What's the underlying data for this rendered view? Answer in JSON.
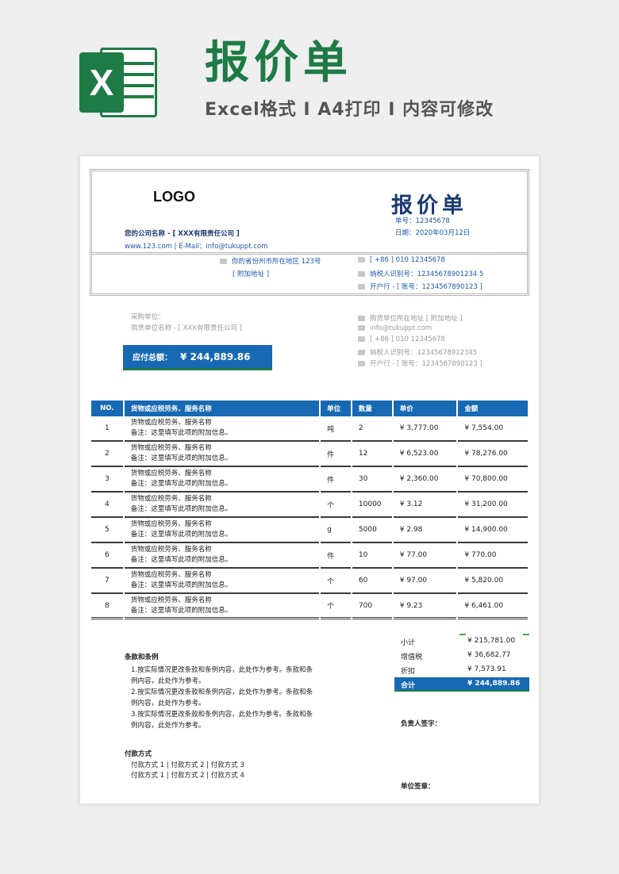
{
  "banner": {
    "icon_letter": "X",
    "title": "报价单",
    "subtitle": "Excel格式 I A4打印 I 内容可修改"
  },
  "header": {
    "logo": "LOGO",
    "doc_title": "报价单",
    "doc_no": "单号：12345678",
    "doc_date": "日期：2020年03月12日",
    "company_name": "您的公司名称  - [ XXX有限责任公司 ]",
    "company_contact": "www.123.com | E-Mail：info@tukuppt.com",
    "address": "你的省份州市所在地区 123号",
    "address_extra": "[ 附加地址 ]",
    "phone": "[ +86 ] 010 12345678",
    "tax_id": "纳税人识别号：12345678901234 5",
    "bank": "开户行 - [ 账号：1234567890123 ]"
  },
  "buyer": {
    "label": "采购单位：",
    "name": "购货单位名称  - [ XXX有限责任公司 ]",
    "address": "购货单位所在地址 [ 附加地址 ]",
    "email": "info@tukuppt.com",
    "phone": "[ +86 ] 010 12345678",
    "tax_id": "纳税人识别号：12345678912345",
    "bank": "开户行 - [ 账号：1234567890123 ]"
  },
  "due": {
    "label": "应付总额：",
    "amount": "¥ 244,889.86"
  },
  "table": {
    "headers": [
      "NO.",
      "货物或应税劳务、服务名称",
      "单位",
      "数量",
      "单价",
      "金额"
    ],
    "rows": [
      {
        "no": "1",
        "name": "货物或应税劳务、服务名称",
        "note": "备注：这里填写此项的附加信息。",
        "unit": "吨",
        "qty": "2",
        "price": "¥ 3,777.00",
        "amount": "¥ 7,554.00"
      },
      {
        "no": "2",
        "name": "货物或应税劳务、服务名称",
        "note": "备注：这里填写此项的附加信息。",
        "unit": "件",
        "qty": "12",
        "price": "¥ 6,523.00",
        "amount": "¥ 78,276.00"
      },
      {
        "no": "3",
        "name": "货物或应税劳务、服务名称",
        "note": "备注：这里填写此项的附加信息。",
        "unit": "件",
        "qty": "30",
        "price": "¥ 2,360.00",
        "amount": "¥ 70,800.00"
      },
      {
        "no": "4",
        "name": "货物或应税劳务、服务名称",
        "note": "备注：这里填写此项的附加信息。",
        "unit": "个",
        "qty": "10000",
        "price": "¥ 3.12",
        "amount": "¥ 31,200.00"
      },
      {
        "no": "5",
        "name": "货物或应税劳务、服务名称",
        "note": "备注：这里填写此项的附加信息。",
        "unit": "g",
        "qty": "5000",
        "price": "¥ 2.98",
        "amount": "¥ 14,900.00"
      },
      {
        "no": "6",
        "name": "货物或应税劳务、服务名称",
        "note": "备注：这里填写此项的附加信息。",
        "unit": "件",
        "qty": "10",
        "price": "¥ 77.00",
        "amount": "¥ 770.00"
      },
      {
        "no": "7",
        "name": "货物或应税劳务、服务名称",
        "note": "备注：这里填写此项的附加信息。",
        "unit": "个",
        "qty": "60",
        "price": "¥ 97.00",
        "amount": "¥ 5,820.00"
      },
      {
        "no": "8",
        "name": "货物或应税劳务、服务名称",
        "note": "备注：这里填写此项的附加信息。",
        "unit": "个",
        "qty": "700",
        "price": "¥ 9.23",
        "amount": "¥ 6,461.00"
      }
    ]
  },
  "summary": {
    "subtotal_label": "小计",
    "subtotal": "¥ 215,781.00",
    "vat_label": "增值税",
    "vat": "¥ 36,682.77",
    "discount_label": "折扣",
    "discount": "¥ 7,573.91",
    "total_label": "合计",
    "total": "¥ 244,889.86"
  },
  "terms": {
    "title": "条款和条例",
    "lines": [
      "1.按实际情况更改条款和条例内容，此处作为参考。条款和条",
      "例内容，此处作为参考。",
      "2.按实际情况更改条款和条例内容，此处作为参考。条款和条",
      "例内容，此处作为参考。",
      "3.按实际情况更改条款和条例内容，此处作为参考。条款和条",
      "例内容，此处作为参考。"
    ]
  },
  "payment": {
    "title": "付款方式",
    "line1": "付款方式 1 | 付款方式 2 | 付款方式 3",
    "line2": "付款方式 1 | 付款方式 2 | 付款方式 4"
  },
  "sign": {
    "person": "负责人签字：",
    "unit": "单位签章："
  }
}
